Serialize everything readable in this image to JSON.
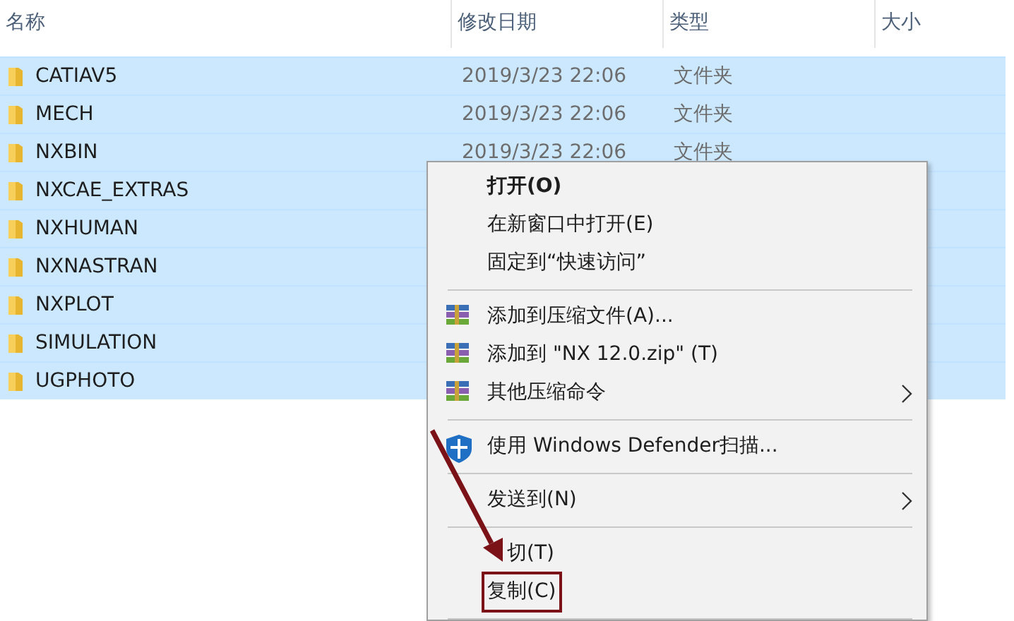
{
  "columns": [
    "名称",
    "修改日期",
    "类型",
    "大小"
  ],
  "rows": [
    {
      "name": "CATIAV5",
      "date": "2019/3/23 22:06",
      "type": "文件夹",
      "selected": true
    },
    {
      "name": "MECH",
      "date": "2019/3/23 22:06",
      "type": "文件夹",
      "selected": true
    },
    {
      "name": "NXBIN",
      "date": "2019/3/23 22:06",
      "type": "文件夹",
      "selected": true
    },
    {
      "name": "NXCAE_EXTRAS",
      "selected": true
    },
    {
      "name": "NXHUMAN",
      "selected": true
    },
    {
      "name": "NXNASTRAN",
      "selected": true
    },
    {
      "name": "NXPLOT",
      "selected": true
    },
    {
      "name": "SIMULATION",
      "selected": true
    },
    {
      "name": "UGPHOTO",
      "selected": true
    }
  ],
  "context_menu": [
    {
      "kind": "command",
      "label": "打开(O)",
      "bold": true
    },
    {
      "kind": "command",
      "label": "在新窗口中打开(E)"
    },
    {
      "kind": "command",
      "label": "固定到“快速访问”"
    },
    {
      "kind": "separator"
    },
    {
      "kind": "archive",
      "label": "添加到压缩文件(A)..."
    },
    {
      "kind": "archive",
      "label": "添加到 \"NX 12.0.zip\" (T)"
    },
    {
      "kind": "archive",
      "label": "其他压缩命令",
      "submenu": true
    },
    {
      "kind": "separator"
    },
    {
      "kind": "shield",
      "label": "使用 Windows Defender扫描..."
    },
    {
      "kind": "separator"
    },
    {
      "kind": "command",
      "label": "发送到(N)",
      "submenu": true
    },
    {
      "kind": "separator"
    },
    {
      "kind": "command",
      "label": "切(T)",
      "partly_covered": true
    },
    {
      "kind": "command",
      "label": "复制(C)",
      "highlighted": true
    },
    {
      "kind": "separator"
    }
  ],
  "annotation": {
    "kind": "arrow"
  }
}
